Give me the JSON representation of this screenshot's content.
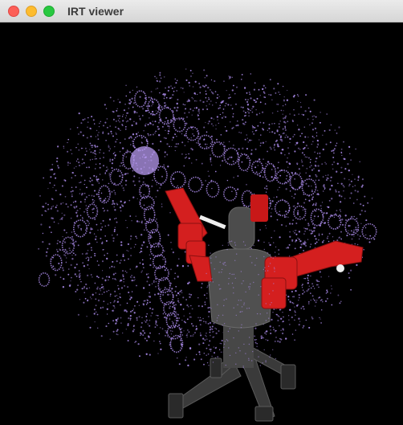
{
  "window": {
    "title": "IRT viewer",
    "buttons": {
      "close": "close-icon",
      "minimize": "minimize-icon",
      "maximize": "maximize-icon"
    }
  },
  "scene": {
    "background": "#000000",
    "point_cloud_color": "#a98ae8",
    "robot_body_color": "#4a4a4a",
    "robot_arm_color": "#d81e1e"
  }
}
